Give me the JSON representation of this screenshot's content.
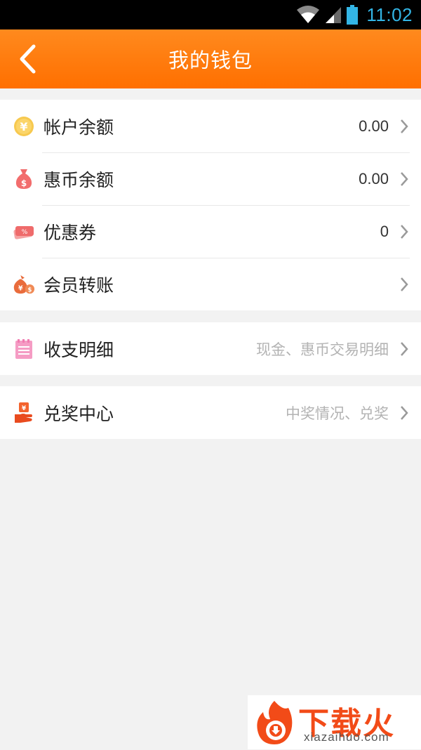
{
  "status_bar": {
    "time": "11:02"
  },
  "header": {
    "title": "我的钱包"
  },
  "groups": [
    {
      "items": [
        {
          "label": "帐户余额",
          "value": "0.00",
          "icon": "yen-coin-icon"
        },
        {
          "label": "惠币余额",
          "value": "0.00",
          "icon": "money-bag-icon"
        },
        {
          "label": "优惠券",
          "value": "0",
          "icon": "coupon-icon"
        },
        {
          "label": "会员转账",
          "value": "",
          "icon": "transfer-bags-icon"
        }
      ]
    },
    {
      "items": [
        {
          "label": "收支明细",
          "hint": "现金、惠币交易明细",
          "icon": "notepad-icon"
        }
      ]
    },
    {
      "items": [
        {
          "label": "兑奖中心",
          "hint": "中奖情况、兑奖",
          "icon": "prize-hand-icon"
        }
      ]
    }
  ],
  "watermark": {
    "title": "下载火",
    "domain": "xiazaihuo.com"
  },
  "colors": {
    "header": "#ff7a0a",
    "status_time": "#33b5e5",
    "background": "#f2f2f2"
  }
}
